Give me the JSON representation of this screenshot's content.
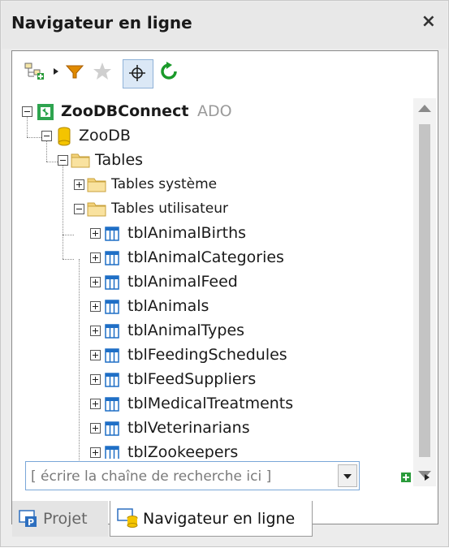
{
  "window": {
    "title": "Navigateur en ligne",
    "close_glyph": "×"
  },
  "toolbar": {
    "icons": [
      "add-connection-icon",
      "menu-arrow-icon",
      "filter-icon",
      "favorite-star-icon",
      "locate-icon",
      "refresh-icon"
    ]
  },
  "tree": {
    "connection": {
      "name": "ZooDBConnect",
      "kind": "ADO"
    },
    "database": "ZooDB",
    "folder_tables": "Tables",
    "folder_system": "Tables système",
    "folder_user": "Tables utilisateur",
    "tables": [
      "tblAnimalBirths",
      "tblAnimalCategories",
      "tblAnimalFeed",
      "tblAnimals",
      "tblAnimalTypes",
      "tblFeedingSchedules",
      "tblFeedSuppliers",
      "tblMedicalTreatments",
      "tblVeterinarians",
      "tblZookeepers"
    ]
  },
  "search": {
    "placeholder": "[ écrire la chaîne de recherche ici ]"
  },
  "tabs": [
    {
      "label": "Projet",
      "active": false
    },
    {
      "label": "Navigateur en ligne",
      "active": true
    }
  ],
  "colors": {
    "accent": "#1f6fc6",
    "filter": "#d98b00",
    "refresh": "#1a9a2a",
    "db": "#e8b800",
    "connection": "#29a84a"
  }
}
